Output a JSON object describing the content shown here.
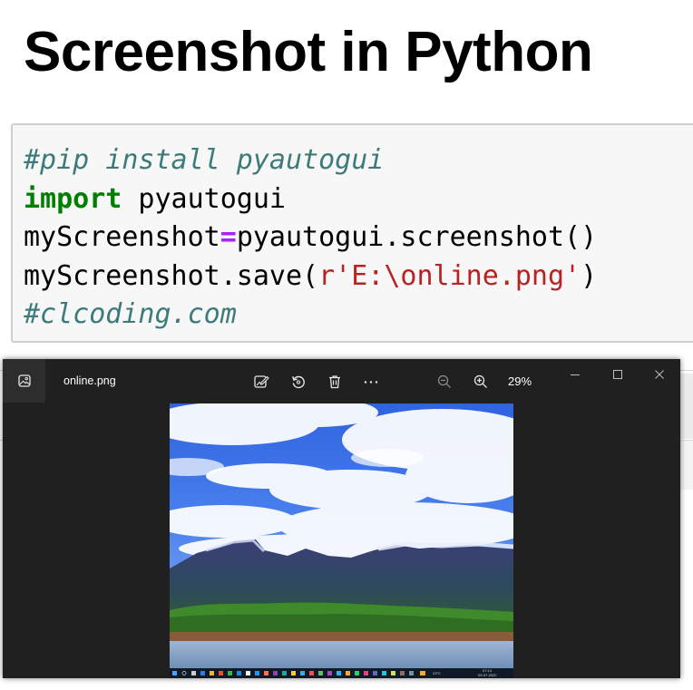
{
  "page": {
    "title": "Screenshot in Python"
  },
  "code": {
    "line1_comment": "#pip install pyautogui",
    "line2_keyword": "import",
    "line2_rest": " pyautogui",
    "line3_var": "myScreenshot",
    "line3_op": "=",
    "line3_rest": "pyautogui.screenshot()",
    "line4_pre": "myScreenshot.save(",
    "line4_string": "r'E:\\online.png'",
    "line4_post": ")",
    "line5_comment": "#clcoding.com",
    "colors": {
      "comment": "#3d7b7b",
      "keyword": "#008000",
      "operator": "#aa22ff",
      "string": "#ba2121",
      "background": "#f7f7f7"
    }
  },
  "viewer": {
    "file_name": "online.png",
    "zoom_level": "29%",
    "icons": {
      "app": "photo-app-icon",
      "edit": "edit-image-icon",
      "rotate": "rotate-icon",
      "delete": "trash-icon",
      "more": "more-icon",
      "zoom_out": "zoom-out-icon",
      "zoom_in": "zoom-in-icon",
      "minimize": "minimize-icon",
      "maximize": "maximize-icon",
      "close": "close-icon"
    },
    "taskbar": {
      "temperature": "23°C",
      "time": "07:14",
      "date": "09-07-2022"
    }
  }
}
